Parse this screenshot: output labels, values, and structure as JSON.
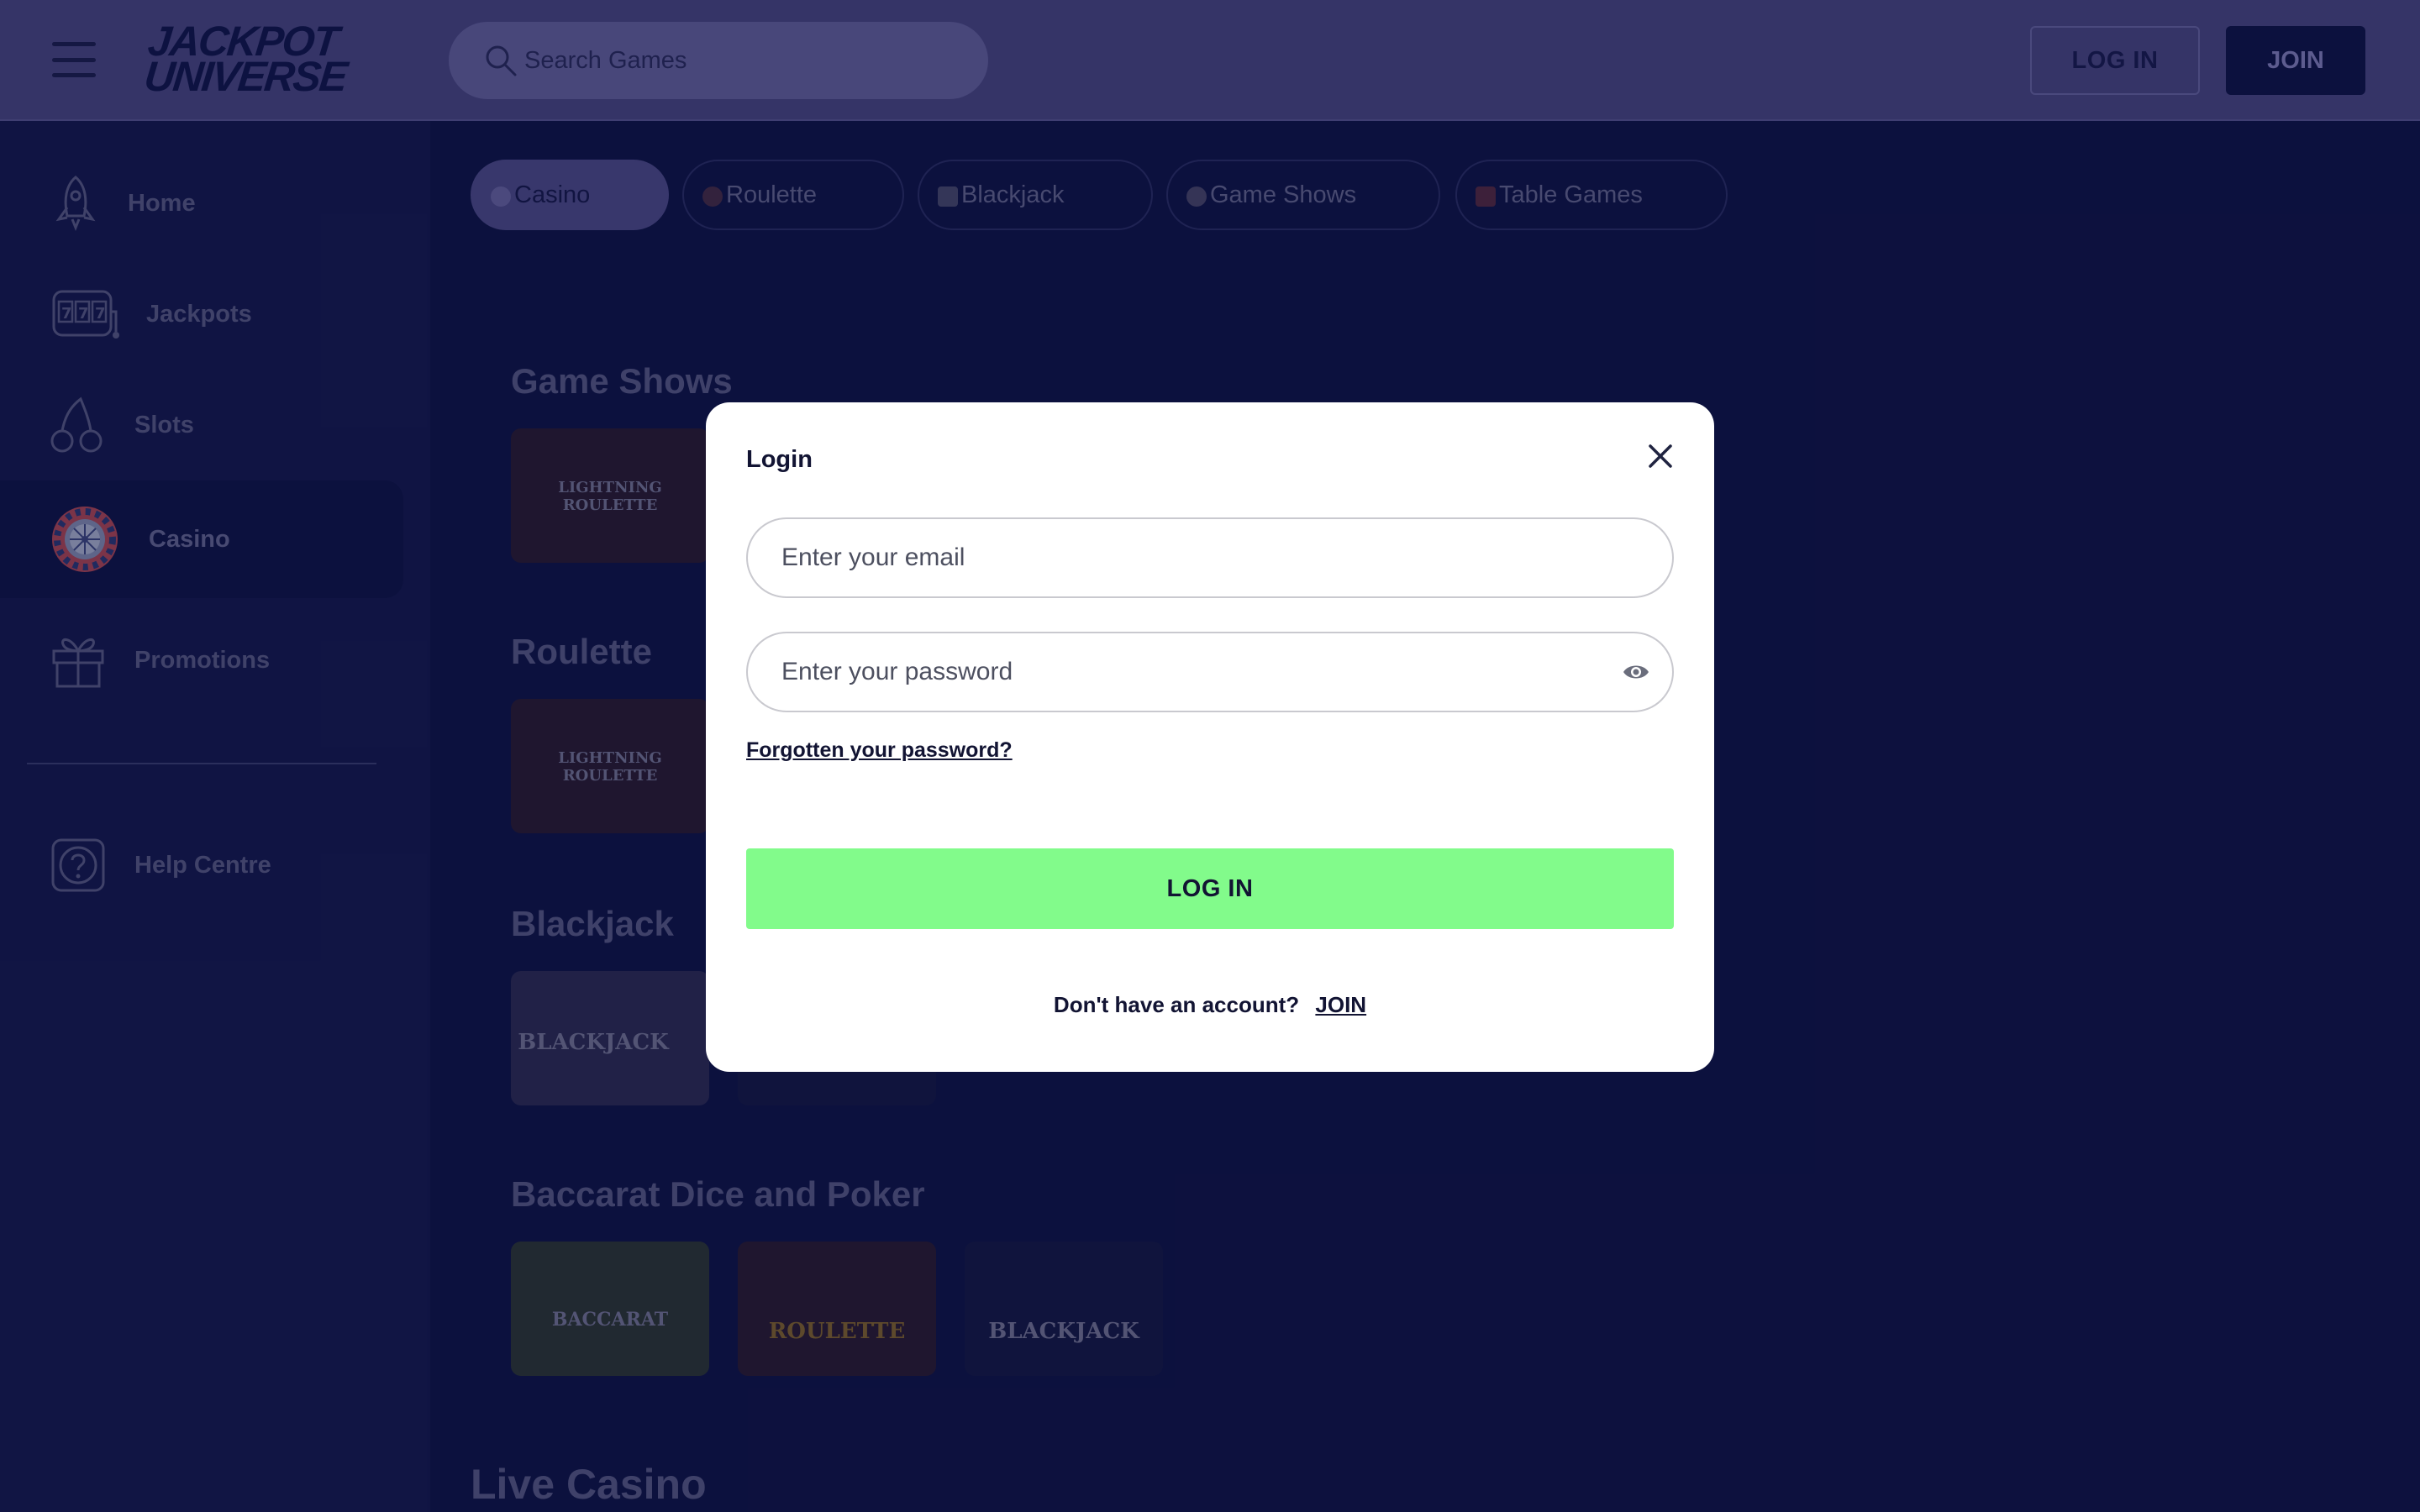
{
  "header": {
    "logo_line1": "JACKPOT",
    "logo_line2": "UNIVERSE",
    "search_placeholder": "Search Games",
    "login_label": "LOG IN",
    "join_label": "JOIN"
  },
  "sidebar": {
    "items": [
      {
        "label": "Home",
        "icon": "rocket-icon"
      },
      {
        "label": "Jackpots",
        "icon": "slot-machine-icon"
      },
      {
        "label": "Slots",
        "icon": "cherries-icon"
      },
      {
        "label": "Casino",
        "icon": "roulette-wheel-icon",
        "active": true
      },
      {
        "label": "Promotions",
        "icon": "gift-icon"
      }
    ],
    "help": {
      "label": "Help Centre",
      "icon": "help-icon"
    }
  },
  "categories": [
    {
      "label": "Casino",
      "active": true
    },
    {
      "label": "Roulette"
    },
    {
      "label": "Blackjack"
    },
    {
      "label": "Game Shows"
    },
    {
      "label": "Table Games"
    }
  ],
  "sections": [
    {
      "title": "Game Shows",
      "thumbs": [
        "LIGHTNING ROULETTE"
      ]
    },
    {
      "title": "Roulette",
      "thumbs": [
        "LIGHTNING ROULETTE"
      ]
    },
    {
      "title": "Blackjack",
      "thumbs": [
        "BLACKJACK"
      ]
    },
    {
      "title": "Baccarat Dice and Poker",
      "thumbs": [
        "BACCARAT",
        "ROULETTE",
        "BLACKJACK"
      ]
    }
  ],
  "live_casino_title": "Live Casino",
  "modal": {
    "title": "Login",
    "email_placeholder": "Enter your email",
    "password_placeholder": "Enter your password",
    "forgot_label": "Forgotten your password?",
    "login_button": "LOG IN",
    "no_account_text": "Don't have an account?",
    "join_link": "JOIN"
  },
  "colors": {
    "header_bg": "#4d4a85",
    "page_bg": "#0f1446",
    "login_green": "#82fb8b"
  }
}
